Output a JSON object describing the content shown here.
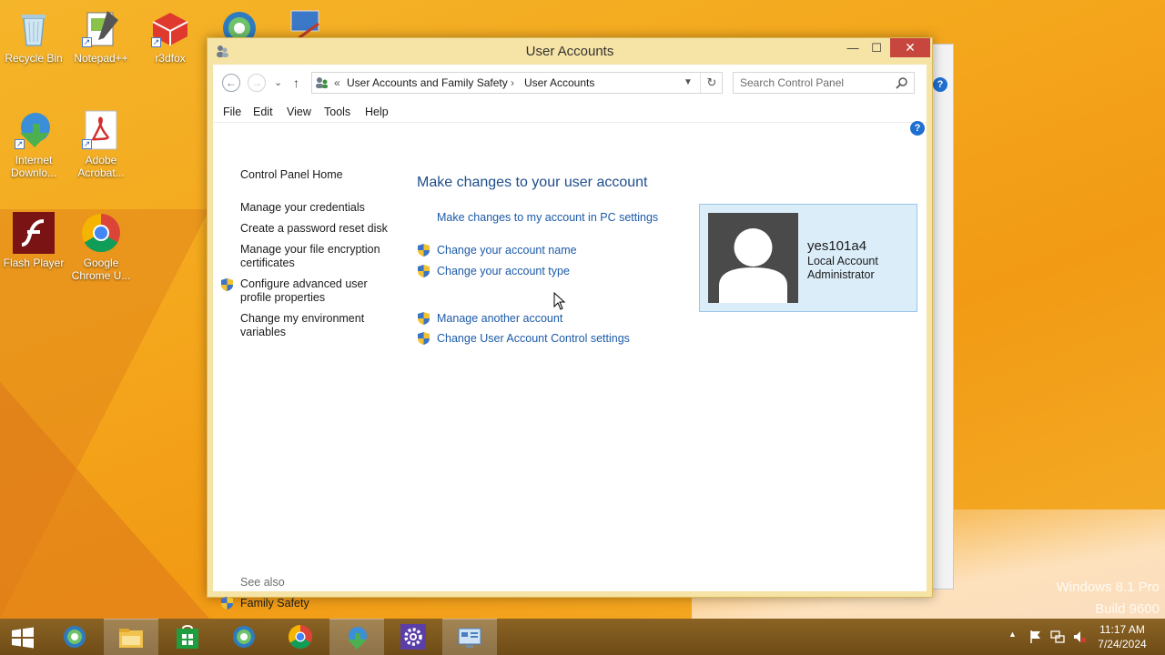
{
  "desktop": {
    "icons": [
      {
        "label": "Recycle Bin"
      },
      {
        "label": "Notepad++"
      },
      {
        "label": "r3dfox"
      },
      {
        "label": "Internet Downlo..."
      },
      {
        "label": "Adobe Acrobat..."
      },
      {
        "label": "Flash Player"
      },
      {
        "label": "Google Chrome U..."
      }
    ],
    "watermark": {
      "line1": "Windows 8.1 Pro",
      "line2": "Build 9600"
    }
  },
  "window": {
    "title": "User Accounts",
    "controls": {
      "minimize": "—",
      "maximize": "☐",
      "close": "✕"
    },
    "nav": {
      "back": "←",
      "forward": "→",
      "recent": "⌄",
      "up": "↑",
      "breadcrumb": {
        "prefix": "«",
        "items": [
          "User Accounts and Family Safety",
          "User Accounts"
        ],
        "separator": "›"
      },
      "refresh": "↻",
      "search_placeholder": "Search Control Panel"
    },
    "menu": [
      "File",
      "Edit",
      "View",
      "Tools",
      "Help"
    ],
    "left_pane": {
      "home": "Control Panel Home",
      "tasks": [
        "Manage your credentials",
        "Create a password reset disk",
        "Manage your file encryption certificates",
        "Configure advanced user profile properties",
        "Change my environment variables"
      ],
      "see_also_label": "See also",
      "see_also": [
        "Family Safety"
      ]
    },
    "main": {
      "heading": "Make changes to your user account",
      "pc_settings_link": "Make changes to my account in PC settings",
      "links_group1": [
        "Change your account name",
        "Change your account type"
      ],
      "links_group2": [
        "Manage another account",
        "Change User Account Control settings"
      ]
    },
    "account": {
      "name": "yes101a4",
      "type": "Local Account",
      "role": "Administrator"
    }
  },
  "taskbar": {
    "clock": {
      "time": "11:17 AM",
      "date": "7/24/2024"
    },
    "tray_overflow": "▲"
  },
  "colors": {
    "link": "#1c5aa8",
    "heading": "#1e4e8c",
    "close_button": "#c7463d",
    "window_frame": "#f6e3a6",
    "account_tile": "#dbedf9"
  }
}
